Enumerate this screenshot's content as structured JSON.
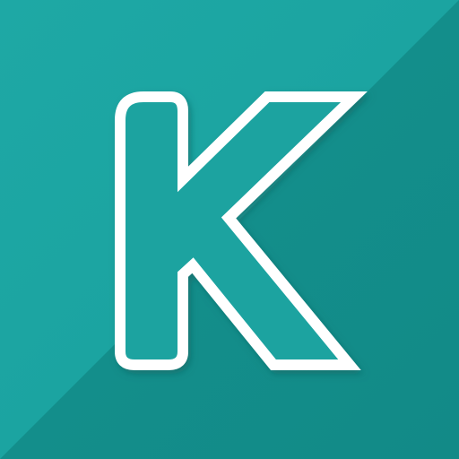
{
  "icon": {
    "letter": "K",
    "name": "k-logo-icon",
    "colors": {
      "background_light": "#1aa4a1",
      "background_dark": "#14908d",
      "letter_fill": "#1ba3a0",
      "letter_stroke": "#ffffff",
      "shadow": "#0b5e5b"
    }
  }
}
